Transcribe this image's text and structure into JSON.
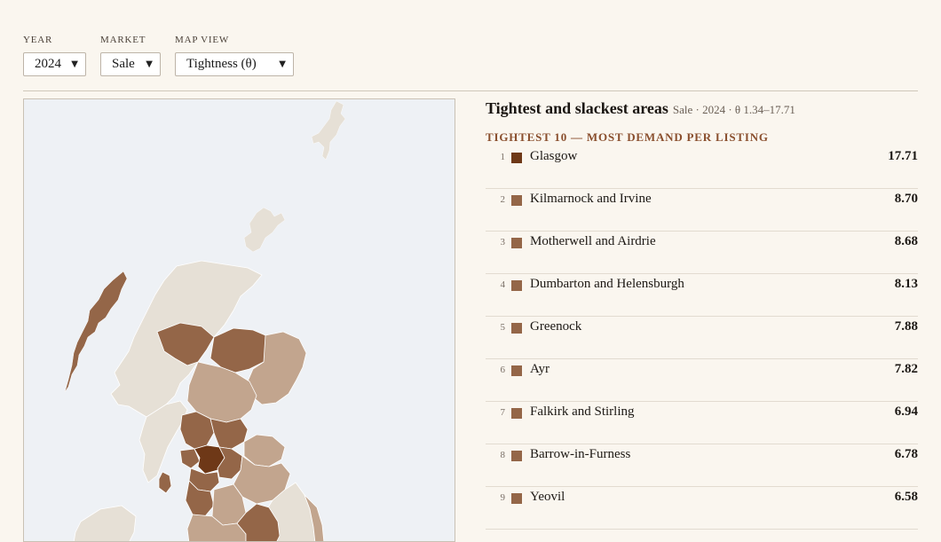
{
  "controls": {
    "year": {
      "label": "YEAR",
      "value": "2024"
    },
    "market": {
      "label": "MARKET",
      "value": "Sale"
    },
    "map_view": {
      "label": "MAP VIEW",
      "value": "Tightness (θ)"
    }
  },
  "panel": {
    "title": "Tightest and slackest areas",
    "meta": "Sale · 2024 · θ 1.34–17.71",
    "section": "TIGHTEST 10 — MOST DEMAND PER LISTING"
  },
  "colors": {
    "max": "#6e3817",
    "high": "#946648",
    "mid": "#c2a58e",
    "low": "#e6e0d6",
    "sea": "#eef1f5"
  },
  "tightest": [
    {
      "rank": "1",
      "name": "Glasgow",
      "value": "17.71",
      "color": "#6e3817"
    },
    {
      "rank": "2",
      "name": "Kilmarnock and Irvine",
      "value": "8.70",
      "color": "#946648"
    },
    {
      "rank": "3",
      "name": "Motherwell and Airdrie",
      "value": "8.68",
      "color": "#946648"
    },
    {
      "rank": "4",
      "name": "Dumbarton and Helensburgh",
      "value": "8.13",
      "color": "#946648"
    },
    {
      "rank": "5",
      "name": "Greenock",
      "value": "7.88",
      "color": "#946648"
    },
    {
      "rank": "6",
      "name": "Ayr",
      "value": "7.82",
      "color": "#946648"
    },
    {
      "rank": "7",
      "name": "Falkirk and Stirling",
      "value": "6.94",
      "color": "#946648"
    },
    {
      "rank": "8",
      "name": "Barrow-in-Furness",
      "value": "6.78",
      "color": "#946648"
    },
    {
      "rank": "9",
      "name": "Yeovil",
      "value": "6.58",
      "color": "#946648"
    }
  ]
}
